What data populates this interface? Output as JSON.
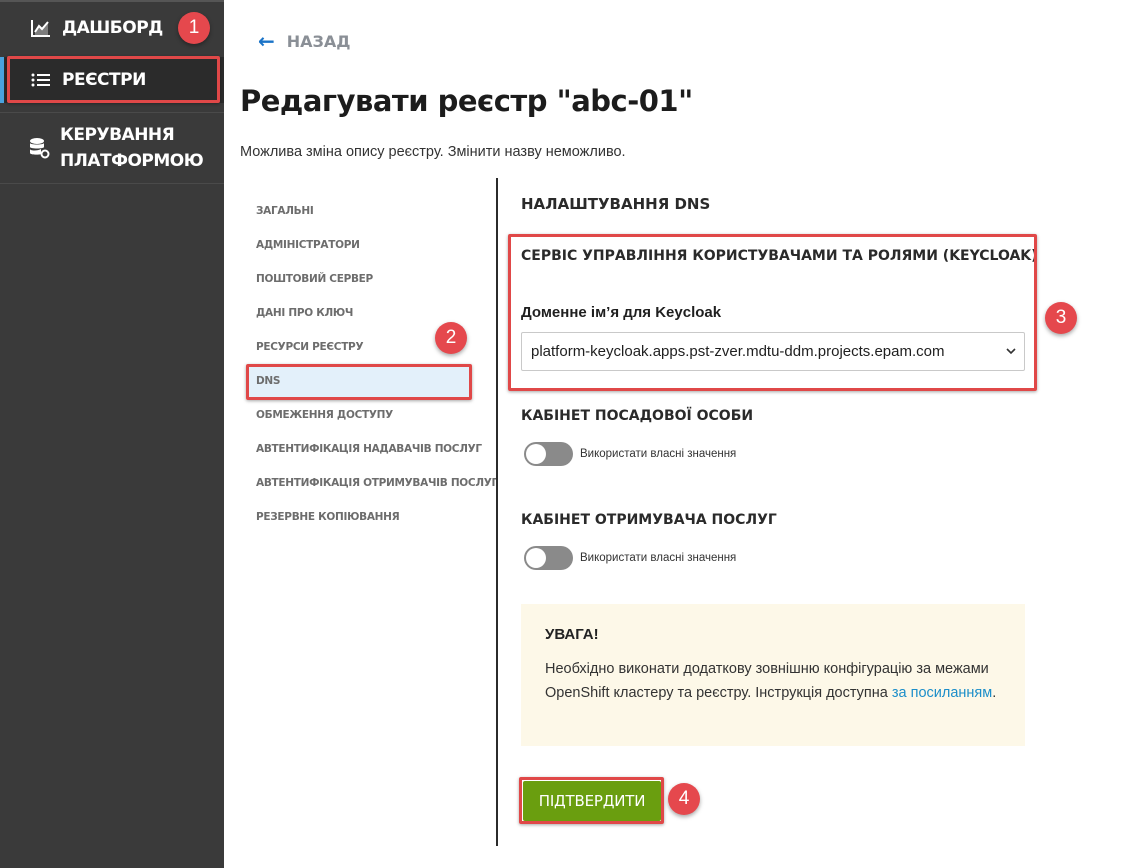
{
  "sidebar": {
    "items": [
      {
        "label": "ДАШБОРД",
        "icon": "chart-line-icon"
      },
      {
        "label": "РЕЄСТРИ",
        "icon": "list-icon"
      },
      {
        "label_line1": "КЕРУВАННЯ",
        "label_line2": "ПЛАТФОРМОЮ",
        "icon": "database-gear-icon"
      }
    ]
  },
  "header": {
    "back_label": "НАЗАД",
    "title": "Редагувати реєстр \"abc-01\"",
    "subtitle": "Можлива зміна опису реєстру. Змінити назву неможливо."
  },
  "menu": {
    "items": [
      "ЗАГАЛЬНІ",
      "АДМІНІСТРАТОРИ",
      "ПОШТОВИЙ СЕРВЕР",
      "ДАНІ ПРО КЛЮЧ",
      "РЕСУРСИ РЕЄСТРУ",
      "DNS",
      "ОБМЕЖЕННЯ ДОСТУПУ",
      "АВТЕНТИФІКАЦІЯ НАДАВАЧІВ ПОСЛУГ",
      "АВТЕНТИФІКАЦІЯ ОТРИМУВАЧІВ ПОСЛУГ",
      "РЕЗЕРВНЕ КОПІЮВАННЯ"
    ],
    "active": "DNS"
  },
  "dns": {
    "title": "НАЛАШТУВАННЯ DNS",
    "keycloak": {
      "title": "СЕРВІС УПРАВЛІННЯ КОРИСТУВАЧАМИ ТА РОЛЯМИ (KEYCLOAK)",
      "field_label": "Доменне ім’я для Keycloak",
      "selected": "platform-keycloak.apps.pst-zver.mdtu-ddm.projects.epam.com"
    },
    "officer": {
      "title": "КАБІНЕТ ПОСАДОВОЇ ОСОБИ",
      "toggle_label": "Використати власні значення",
      "toggle_on": false
    },
    "citizen": {
      "title": "КАБІНЕТ ОТРИМУВАЧА ПОСЛУГ",
      "toggle_label": "Використати власні значення",
      "toggle_on": false
    },
    "alert": {
      "title": "УВАГА!",
      "text": "Необхідно виконати додаткову зовнішню конфігурацію за межами OpenShift кластеру та реєстру. Інструкція доступна ",
      "link_text": "за посиланням",
      "text_end": "."
    },
    "confirm_label": "ПІДТВЕРДИТИ"
  },
  "annotations": [
    "1",
    "2",
    "3",
    "4"
  ],
  "colors": {
    "sidebar_bg": "#3a3a3a",
    "accent_blue": "#4aa3df",
    "highlight_red": "#e04848",
    "confirm_green": "#6a9e0f",
    "alert_bg": "#fdf8e8",
    "link": "#1c8ec9"
  }
}
